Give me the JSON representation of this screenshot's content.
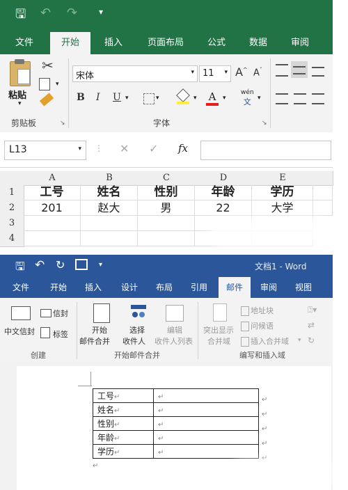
{
  "excel": {
    "qat": {
      "save": "🖫",
      "undo": "↶",
      "redo": "↷",
      "more": "▾"
    },
    "tabs": [
      "文件",
      "开始",
      "插入",
      "页面布局",
      "公式",
      "数据",
      "审阅"
    ],
    "active_tab": "开始",
    "clipboard": {
      "paste": "粘贴",
      "group": "剪贴板"
    },
    "font": {
      "name": "宋体",
      "size": "11",
      "grow": "A",
      "shrink": "A",
      "bold": "B",
      "italic": "I",
      "underline": "U",
      "wen_top": "wén",
      "wen_bottom": "文",
      "group": "字体"
    },
    "name_box": "L13",
    "fx": "fx",
    "cancel": "✕",
    "enter": "✓",
    "columns": [
      "A",
      "B",
      "C",
      "D",
      "E"
    ],
    "rows": [
      "1",
      "2",
      "3",
      "4"
    ],
    "header_row": [
      "工号",
      "姓名",
      "性别",
      "年龄",
      "学历"
    ],
    "data_row": [
      "201",
      "赵大",
      "男",
      "22",
      "大学"
    ]
  },
  "word": {
    "title": "文档1 - Word",
    "tabs": [
      "文件",
      "开始",
      "插入",
      "设计",
      "布局",
      "引用",
      "邮件",
      "审阅",
      "视图"
    ],
    "active_tab": "邮件",
    "create": {
      "chinese_envelope": "中文信封",
      "envelope": "信封",
      "labels": "标签",
      "group": "创建"
    },
    "merge": {
      "start_line1": "开始",
      "start_line2": "邮件合并",
      "select_line1": "选择",
      "select_line2": "收件人",
      "edit_line1": "编辑",
      "edit_line2": "收件人列表",
      "group": "开始邮件合并"
    },
    "write": {
      "highlight_line1": "突出显示",
      "highlight_line2": "合并域",
      "address_block": "地址块",
      "greeting": "问候语",
      "insert_field": "插入合并域",
      "group": "编写和插入域"
    },
    "table_labels": [
      "工号",
      "姓名",
      "性别",
      "年龄",
      "学历"
    ],
    "para_mark": "↵"
  }
}
